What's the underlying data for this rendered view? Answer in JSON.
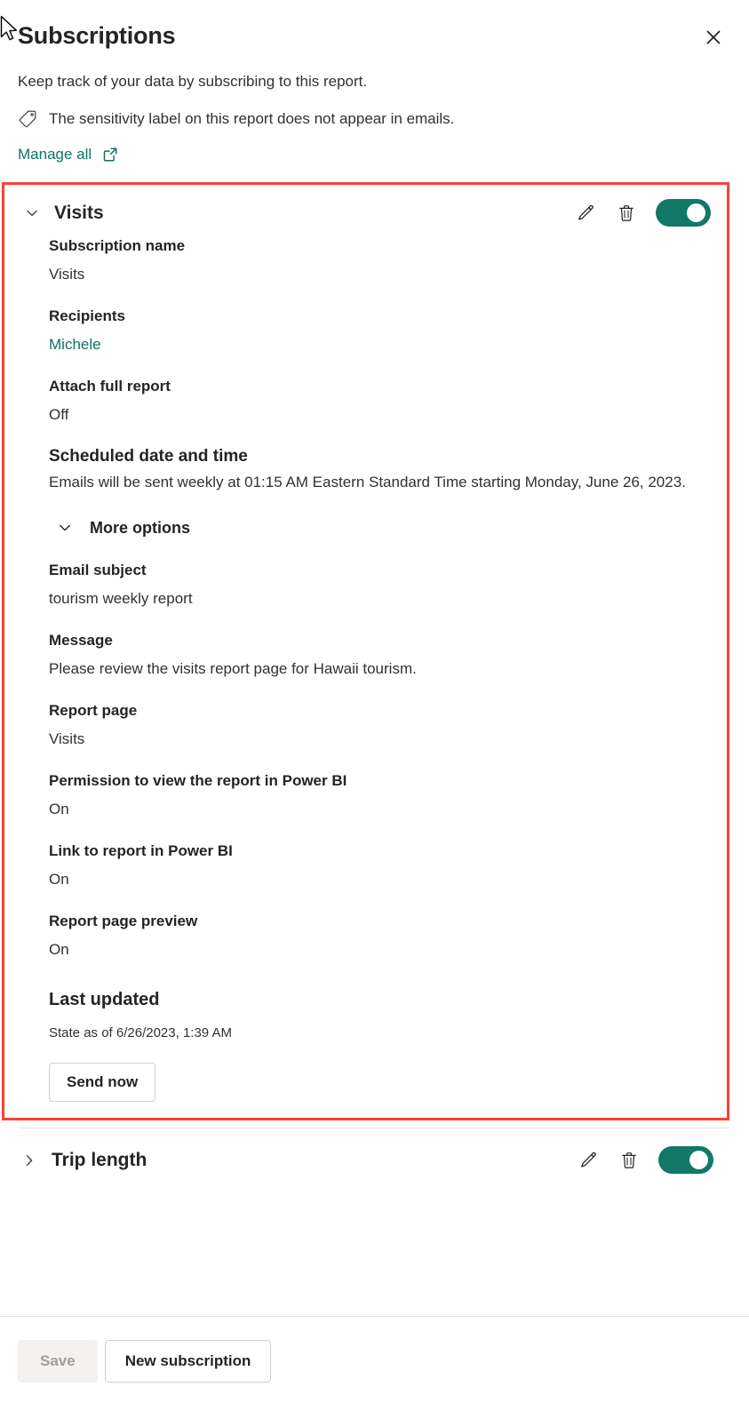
{
  "panel": {
    "title": "Subscriptions",
    "close_label": "Close",
    "subtitle": "Keep track of your data by subscribing to this report.",
    "sensitivity_notice": "The sensitivity label on this report does not appear in emails.",
    "manage_all_label": "Manage all"
  },
  "subscription": {
    "name": "Visits",
    "expanded": true,
    "toggle_state": "On",
    "fields": [
      {
        "label": "Subscription name",
        "value": "Visits",
        "style": "normal"
      },
      {
        "label": "Recipients",
        "value": "Michele",
        "style": "link"
      },
      {
        "label": "Attach full report",
        "value": "Off",
        "style": "normal"
      }
    ],
    "schedule": {
      "label": "Scheduled date and time",
      "value": "Emails will be sent weekly at 01:15 AM Eastern Standard Time starting Monday, June 26, 2023."
    },
    "more_options_label": "More options",
    "more_options_fields": [
      {
        "label": "Email subject",
        "value": "tourism weekly report"
      },
      {
        "label": "Message",
        "value": "Please review the visits report page for Hawaii tourism."
      },
      {
        "label": "Report page",
        "value": "Visits"
      },
      {
        "label": "Permission to view the report in Power BI",
        "value": "On"
      },
      {
        "label": "Link to report in Power BI",
        "value": "On"
      },
      {
        "label": "Report page preview",
        "value": "On"
      }
    ],
    "last_updated_label": "Last updated",
    "last_updated_value": "State as of 6/26/2023, 1:39 AM",
    "send_now_label": "Send now"
  },
  "subscription_collapsed": {
    "name": "Trip length",
    "expanded": false,
    "toggle_state": "On"
  },
  "footer": {
    "save_label": "Save",
    "save_disabled": true,
    "new_subscription_label": "New subscription"
  },
  "colors": {
    "accent_teal": "#0f7362",
    "toggle_on": "#117865",
    "highlight_red": "#fa4238",
    "text_primary": "#252423",
    "text_secondary": "#323130",
    "disabled_bg": "#f3f2f1",
    "border": "#d2d0ce",
    "divider": "#e1dfdd"
  },
  "icons": {
    "close": "close-icon",
    "sensitivity": "tag-icon",
    "external_link": "external-link-icon",
    "edit": "pencil-icon",
    "delete": "trash-icon",
    "chevron_down": "chevron-down-icon",
    "chevron_right": "chevron-right-icon"
  }
}
